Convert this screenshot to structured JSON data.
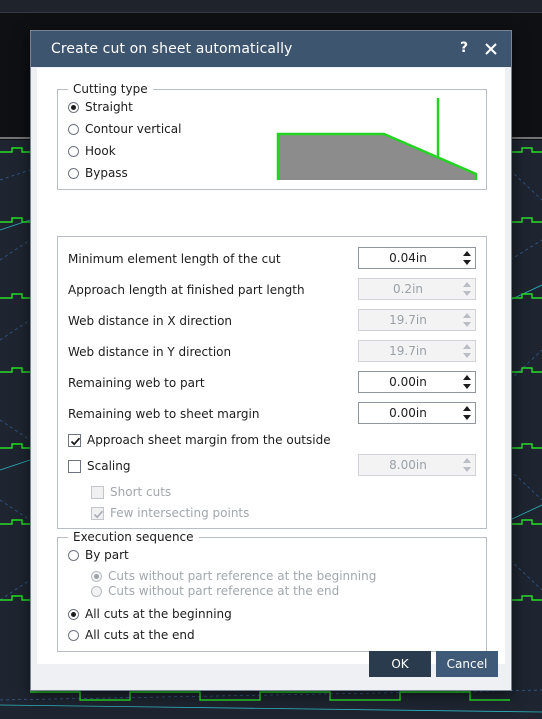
{
  "dialog": {
    "title": "Create cut on sheet automatically",
    "help_label": "?",
    "close_icon": "close-icon"
  },
  "cutting_type": {
    "legend": "Cutting type",
    "options": [
      {
        "label": "Straight",
        "checked": true
      },
      {
        "label": "Contour vertical",
        "checked": false
      },
      {
        "label": "Hook",
        "checked": false
      },
      {
        "label": "Bypass",
        "checked": false
      }
    ],
    "preview_colors": {
      "fill": "#8c8c8c",
      "edge": "#22d322"
    }
  },
  "parameters": {
    "min_element_length": {
      "label": "Minimum element length of the cut",
      "value": "0.04in",
      "enabled": true
    },
    "approach_length": {
      "label": "Approach length at finished part length",
      "value": "0.2in",
      "enabled": false
    },
    "web_distance_x": {
      "label": "Web distance in X direction",
      "value": "19.7in",
      "enabled": false
    },
    "web_distance_y": {
      "label": "Web distance in Y direction",
      "value": "19.7in",
      "enabled": false
    },
    "remaining_web_part": {
      "label": "Remaining web to part",
      "value": "0.00in",
      "enabled": true
    },
    "remaining_web_margin": {
      "label": "Remaining web to sheet margin",
      "value": "0.00in",
      "enabled": true
    },
    "approach_outside": {
      "label": "Approach sheet margin from the outside",
      "checked": true
    },
    "scaling": {
      "label": "Scaling",
      "checked": false,
      "value": "8.00in",
      "enabled": false
    },
    "short_cuts": {
      "label": "Short cuts",
      "checked": false,
      "enabled": false
    },
    "few_intersecting": {
      "label": "Few intersecting points",
      "checked": true,
      "enabled": false
    }
  },
  "execution_sequence": {
    "legend": "Execution sequence",
    "by_part": {
      "label": "By part",
      "checked": false
    },
    "sub_options": [
      {
        "label": "Cuts without part reference at the beginning",
        "checked": true
      },
      {
        "label": "Cuts without part reference at the end",
        "checked": false
      }
    ],
    "all_beginning": {
      "label": "All cuts at the beginning",
      "checked": true
    },
    "all_end": {
      "label": "All cuts at the end",
      "checked": false
    }
  },
  "buttons": {
    "ok": "OK",
    "cancel": "Cancel"
  },
  "colors": {
    "titlebar": "#3e5570",
    "ok_button": "#2b3b4e",
    "cancel_button": "#3f5a78",
    "background_canvas": "#0e1014"
  }
}
